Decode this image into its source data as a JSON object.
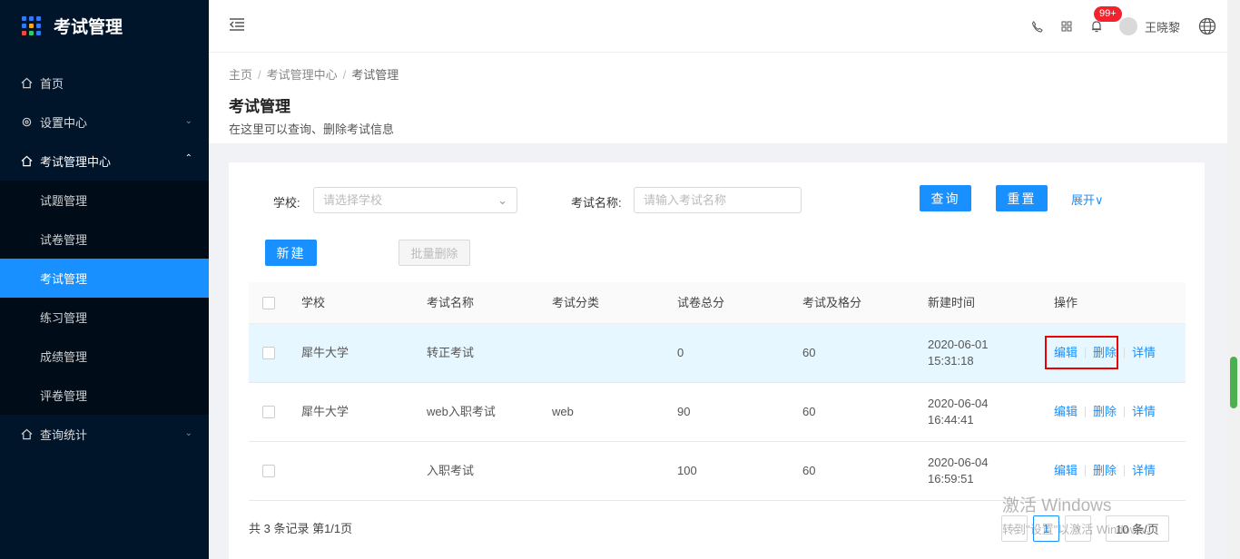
{
  "app": {
    "title": "考试管理"
  },
  "sidebar": {
    "items": [
      {
        "label": "首页",
        "icon": "home-icon"
      },
      {
        "label": "设置中心",
        "icon": "gear-icon"
      },
      {
        "label": "考试管理中心",
        "icon": "home-icon",
        "open": true,
        "children": [
          {
            "label": "试题管理"
          },
          {
            "label": "试卷管理"
          },
          {
            "label": "考试管理",
            "active": true
          },
          {
            "label": "练习管理"
          },
          {
            "label": "成绩管理"
          },
          {
            "label": "评卷管理"
          }
        ]
      },
      {
        "label": "查询统计",
        "icon": "home-icon"
      }
    ]
  },
  "header": {
    "badge": "99+",
    "username": "王晓黎"
  },
  "breadcrumb": [
    "主页",
    "考试管理中心",
    "考试管理"
  ],
  "page": {
    "title": "考试管理",
    "description": "在这里可以查询、删除考试信息"
  },
  "filters": {
    "school_label": "学校:",
    "school_placeholder": "请选择学校",
    "name_label": "考试名称:",
    "name_placeholder": "请输入考试名称",
    "query_button": "查询",
    "reset_button": "重置",
    "expand_link": "展开"
  },
  "toolbar": {
    "new_button": "新建",
    "batch_delete_button": "批量删除"
  },
  "table": {
    "columns": [
      "学校",
      "考试名称",
      "考试分类",
      "试卷总分",
      "考试及格分",
      "新建时间",
      "操作"
    ],
    "rows": [
      {
        "school": "犀牛大学",
        "name": "转正考试",
        "category": "",
        "total": "0",
        "pass": "60",
        "date": "2020-06-01",
        "time": "15:31:18"
      },
      {
        "school": "犀牛大学",
        "name": "web入职考试",
        "category": "web",
        "total": "90",
        "pass": "60",
        "date": "2020-06-04",
        "time": "16:44:41"
      },
      {
        "school": "",
        "name": "入职考试",
        "category": "",
        "total": "100",
        "pass": "60",
        "date": "2020-06-04",
        "time": "16:59:51"
      }
    ],
    "actions": {
      "edit": "编辑",
      "delete": "删除",
      "detail": "详情"
    }
  },
  "footer": {
    "summary": "共 3 条记录 第1/1页",
    "current_page": "1",
    "page_size": "10 条/页"
  },
  "watermark": {
    "line1": "激活 Windows",
    "line2": "转到\"设置\"以激活 Windows。"
  },
  "colors": {
    "sidebar_bg": "#001529",
    "primary": "#1890ff",
    "highlight_row": "#e6f7ff",
    "badge": "#f5222d"
  }
}
